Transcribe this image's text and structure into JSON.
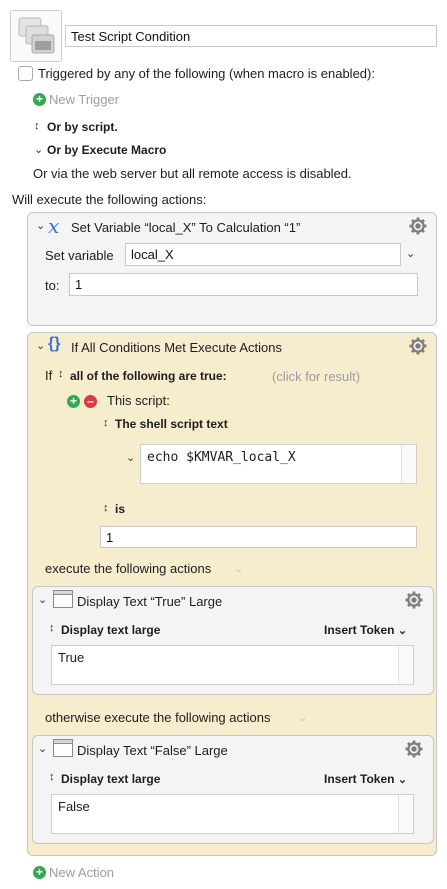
{
  "macro": {
    "name": "Test Script Condition"
  },
  "triggers": {
    "checkbox_label": "Triggered by any of the following (when macro is enabled):",
    "new_trigger": "New Trigger",
    "or_by_script": "Or by script.",
    "or_by_execute_macro": "Or by Execute Macro",
    "web_server_note": "Or via the web server but all remote access is disabled."
  },
  "actions_header": "Will execute the following actions:",
  "set_variable": {
    "title": "Set Variable “local_X” To Calculation “1”",
    "set_variable_label": "Set variable",
    "variable_name": "local_X",
    "to_label": "to:",
    "to_value": "1"
  },
  "if_action": {
    "title": "If All Conditions Met Execute Actions",
    "if_label": "If",
    "condition_mode": "all of the following are true:",
    "click_for_result": "(click for result)",
    "this_script": "This script:",
    "shell_script_label": "The shell script text",
    "script_text": "echo $KMVAR_local_X",
    "is_label": "is",
    "is_value": "1",
    "then_label": "execute the following actions",
    "else_label": "otherwise execute the following actions"
  },
  "display_true": {
    "title": "Display Text “True” Large",
    "mode_label": "Display text large",
    "insert_token": "Insert Token",
    "text": "True"
  },
  "display_false": {
    "title": "Display Text “False” Large",
    "mode_label": "Display text large",
    "insert_token": "Insert Token",
    "text": "False"
  },
  "new_action": "New Action",
  "colors": {
    "if_background": "#f6edcf",
    "action_background": "#f4f4f4",
    "variable_icon": "#3b6fd6",
    "add_green": "#34a853",
    "remove_red": "#e0393e"
  },
  "icons": {
    "macro_icon": "stacked-windows-icon",
    "gear": "gear-icon",
    "variable": "italic-x-icon",
    "if": "braces-icon",
    "display_text": "window-icon"
  }
}
